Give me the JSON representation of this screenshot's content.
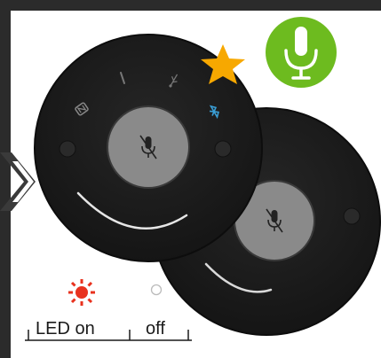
{
  "icons": {
    "star": "star-icon",
    "mic_badge": "microphone-icon",
    "arrow": "chevron-right-icon",
    "nfc": "nfc-icon",
    "aux": "aux-cable-icon",
    "usb": "usb-icon",
    "bluetooth": "bluetooth-icon",
    "mute": "microphone-muted-icon",
    "led_on": "led-on-icon",
    "led_off": "led-off-icon"
  },
  "colors": {
    "background": "#2b2b2b",
    "panel": "#ffffff",
    "device_body": "#1c1c1c",
    "mute_button": "#8a8a8a",
    "star": "#f7a800",
    "mic_badge": "#6dbb1f",
    "led_on": "#e8321e",
    "led_off": "#bbbbbb",
    "bluetooth_active": "#3a9fd6"
  },
  "legend": {
    "led_on_label": "LED on",
    "led_off_label": "off"
  }
}
